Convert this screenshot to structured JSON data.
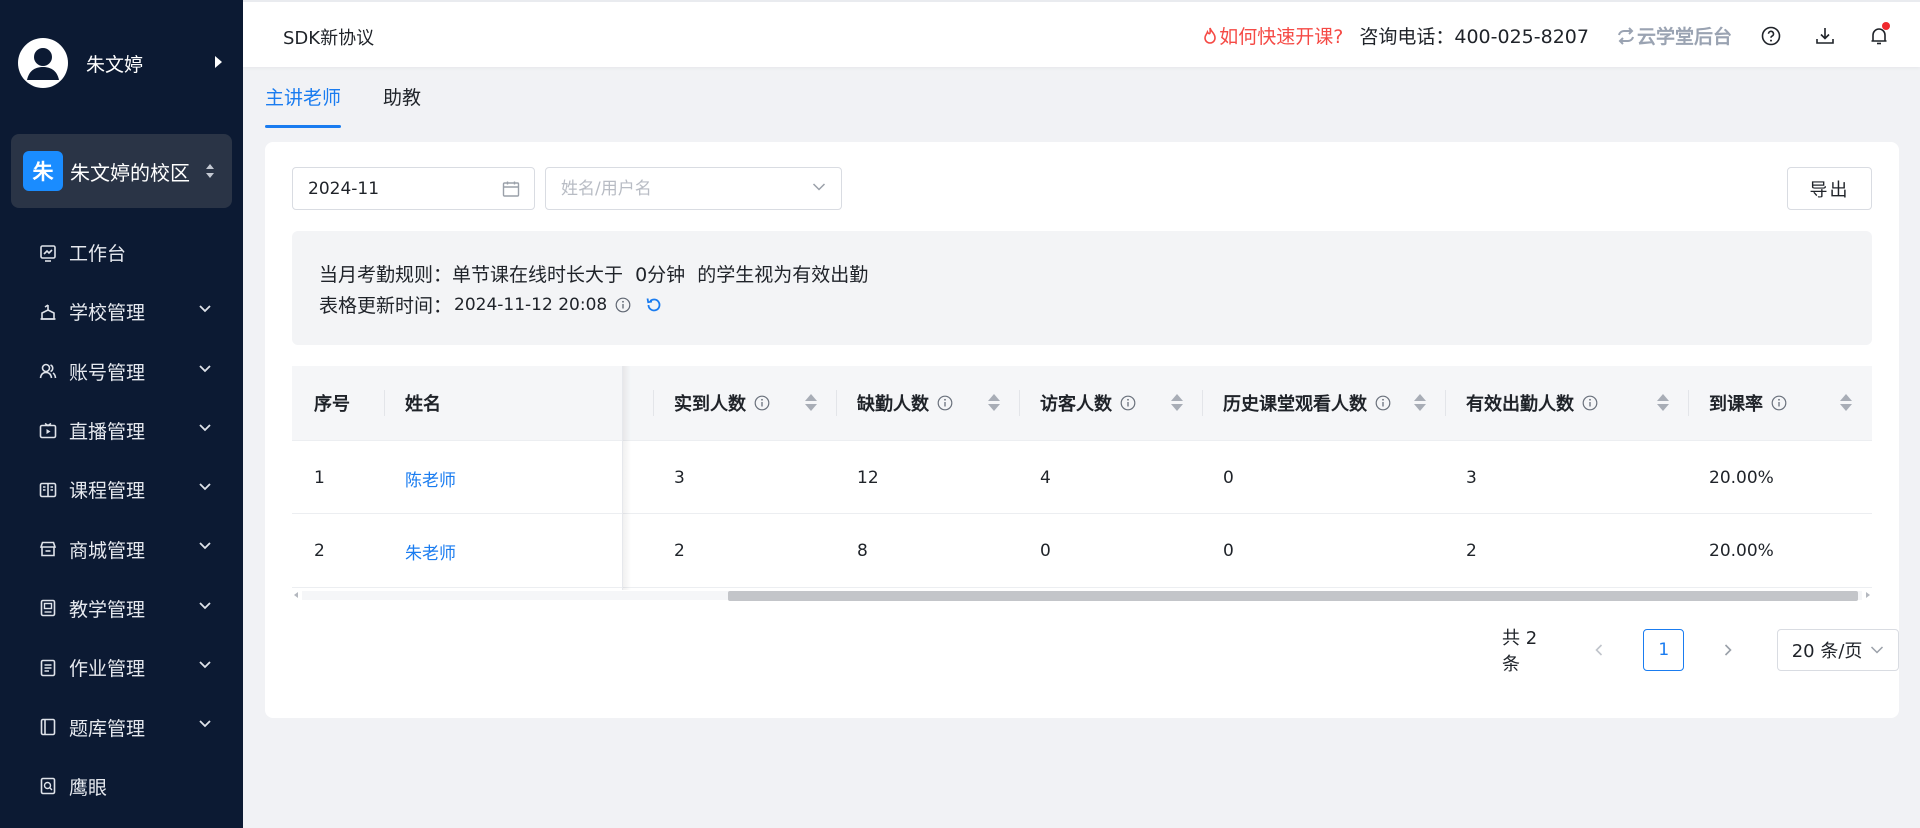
{
  "sidebar": {
    "user_name": "朱文婷",
    "campus": {
      "badge": "朱",
      "name": "朱文婷的校区"
    },
    "items": [
      {
        "label": "工作台",
        "icon": "chart-board-icon",
        "expandable": false
      },
      {
        "label": "学校管理",
        "icon": "school-icon",
        "expandable": true
      },
      {
        "label": "账号管理",
        "icon": "users-icon",
        "expandable": true
      },
      {
        "label": "直播管理",
        "icon": "live-tv-icon",
        "expandable": true
      },
      {
        "label": "课程管理",
        "icon": "book-open-icon",
        "expandable": true
      },
      {
        "label": "商城管理",
        "icon": "shop-icon",
        "expandable": true
      },
      {
        "label": "教学管理",
        "icon": "teaching-icon",
        "expandable": true
      },
      {
        "label": "作业管理",
        "icon": "homework-icon",
        "expandable": true
      },
      {
        "label": "题库管理",
        "icon": "question-bank-icon",
        "expandable": true
      },
      {
        "label": "鹰眼",
        "icon": "eagle-eye-icon",
        "expandable": false
      }
    ]
  },
  "header": {
    "title": "SDK新协议",
    "quick_start": "如何快速开课?",
    "phone": "咨询电话：400-025-8207",
    "brand": "云学堂后台"
  },
  "tabs": [
    {
      "label": "主讲老师",
      "active": true
    },
    {
      "label": "助教",
      "active": false
    }
  ],
  "filters": {
    "month": "2024-11",
    "name_placeholder": "姓名/用户名",
    "export_label": "导出"
  },
  "notice": {
    "rule": "当月考勤规则：单节课在线时长大于  0分钟  的学生视为有效出勤",
    "update_label": "表格更新时间：",
    "update_time": "2024-11-12 20:08"
  },
  "table": {
    "columns": {
      "index": "序号",
      "name": "姓名",
      "attended": "实到人数",
      "absent": "缺勤人数",
      "visitors": "访客人数",
      "history_viewers": "历史课堂观看人数",
      "valid_attendance": "有效出勤人数",
      "attendance_rate": "到课率"
    },
    "rows": [
      {
        "index": "1",
        "name": "陈老师",
        "attended": "3",
        "absent": "12",
        "visitors": "4",
        "history_viewers": "0",
        "valid_attendance": "3",
        "attendance_rate": "20.00%"
      },
      {
        "index": "2",
        "name": "朱老师",
        "attended": "2",
        "absent": "8",
        "visitors": "0",
        "history_viewers": "0",
        "valid_attendance": "2",
        "attendance_rate": "20.00%"
      }
    ]
  },
  "pagination": {
    "total": "共 2 条",
    "current_page": "1",
    "page_size": "20 条/页"
  },
  "colors": {
    "sidebar_bg": "#0c1a33",
    "accent": "#1a7cf0",
    "alert": "#f54a45"
  }
}
